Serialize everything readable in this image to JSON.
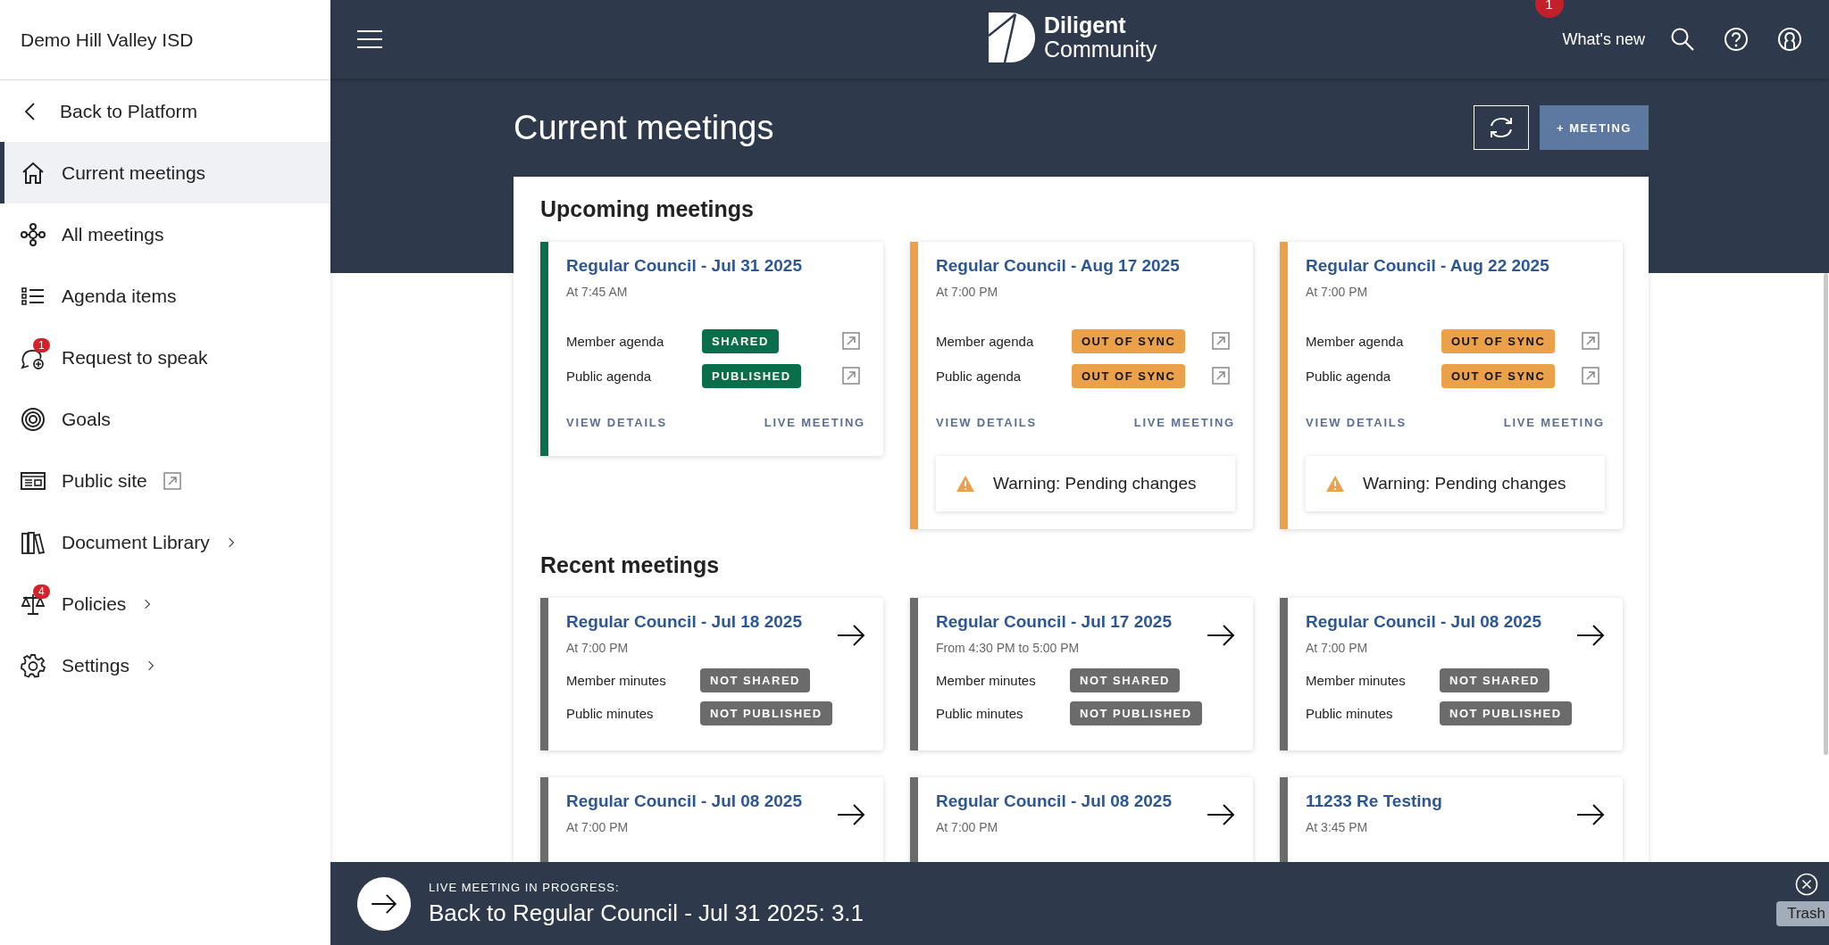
{
  "sidebar": {
    "org": "Demo Hill Valley ISD",
    "back": "Back to Platform",
    "items": [
      {
        "kind": "home",
        "label": "Current meetings",
        "selected": true
      },
      {
        "kind": "network",
        "label": "All meetings",
        "selected": false
      },
      {
        "kind": "list",
        "label": "Agenda items",
        "selected": false
      },
      {
        "kind": "speech",
        "label": "Request to speak",
        "selected": false,
        "badge": "1"
      },
      {
        "kind": "target",
        "label": "Goals",
        "selected": false
      },
      {
        "kind": "site",
        "label": "Public site",
        "selected": false,
        "external": true
      },
      {
        "kind": "books",
        "label": "Document Library",
        "selected": false,
        "submenu": true
      },
      {
        "kind": "scales",
        "label": "Policies",
        "selected": false,
        "badge": "4",
        "submenu": true
      },
      {
        "kind": "gear",
        "label": "Settings",
        "selected": false,
        "submenu": true
      }
    ]
  },
  "header": {
    "logo": {
      "line1": "Diligent",
      "line2": "Community"
    },
    "whats_new": "What's new",
    "whats_new_badge": "1"
  },
  "page": {
    "title": "Current meetings",
    "new_button": "+ MEETING"
  },
  "upcoming": {
    "heading": "Upcoming meetings",
    "cards": [
      {
        "title": "Regular Council - Jul 31 2025",
        "time": "At 7:45 AM",
        "color": "#0b6e4a",
        "rows": [
          {
            "label": "Member agenda",
            "badge": "SHARED",
            "kind": "success"
          },
          {
            "label": "Public agenda",
            "badge": "PUBLISHED",
            "kind": "success"
          }
        ],
        "view_details": "VIEW DETAILS",
        "live_meeting": "LIVE MEETING"
      },
      {
        "title": "Regular Council - Aug 17 2025",
        "time": "At 7:00 PM",
        "color": "#eba14a",
        "rows": [
          {
            "label": "Member agenda",
            "badge": "OUT OF SYNC",
            "kind": "warning"
          },
          {
            "label": "Public agenda",
            "badge": "OUT OF SYNC",
            "kind": "warning"
          }
        ],
        "view_details": "VIEW DETAILS",
        "live_meeting": "LIVE MEETING",
        "warning": "Warning: Pending changes"
      },
      {
        "title": "Regular Council - Aug 22 2025",
        "time": "At 7:00 PM",
        "color": "#eba14a",
        "rows": [
          {
            "label": "Member agenda",
            "badge": "OUT OF SYNC",
            "kind": "warning"
          },
          {
            "label": "Public agenda",
            "badge": "OUT OF SYNC",
            "kind": "warning"
          }
        ],
        "view_details": "VIEW DETAILS",
        "live_meeting": "LIVE MEETING",
        "warning": "Warning: Pending changes"
      }
    ]
  },
  "recent": {
    "heading": "Recent meetings",
    "cards": [
      {
        "title": "Regular Council - Jul 18 2025",
        "time": "At 7:00 PM",
        "color": "#6b6b6b",
        "rows": [
          {
            "label": "Member minutes",
            "badge": "NOT SHARED",
            "kind": "neutral"
          },
          {
            "label": "Public minutes",
            "badge": "NOT PUBLISHED",
            "kind": "neutral"
          }
        ]
      },
      {
        "title": "Regular Council - Jul 17 2025",
        "time": "From 4:30 PM to 5:00 PM",
        "color": "#6b6b6b",
        "rows": [
          {
            "label": "Member minutes",
            "badge": "NOT SHARED",
            "kind": "neutral"
          },
          {
            "label": "Public minutes",
            "badge": "NOT PUBLISHED",
            "kind": "neutral"
          }
        ]
      },
      {
        "title": "Regular Council - Jul 08 2025",
        "time": "At 7:00 PM",
        "color": "#6b6b6b",
        "rows": [
          {
            "label": "Member minutes",
            "badge": "NOT SHARED",
            "kind": "neutral"
          },
          {
            "label": "Public minutes",
            "badge": "NOT PUBLISHED",
            "kind": "neutral"
          }
        ]
      },
      {
        "title": "Regular Council - Jul 08 2025",
        "time": "At 7:00 PM",
        "color": "#6b6b6b"
      },
      {
        "title": "Regular Council - Jul 08 2025",
        "time": "At 7:00 PM",
        "color": "#6b6b6b"
      },
      {
        "title": "11233 Re Testing",
        "time": "At 3:45 PM",
        "color": "#6b6b6b"
      }
    ]
  },
  "banner": {
    "label": "LIVE MEETING IN PROGRESS:",
    "title": "Back to Regular Council - Jul 31 2025: 3.1",
    "tooltip": "Trash"
  }
}
